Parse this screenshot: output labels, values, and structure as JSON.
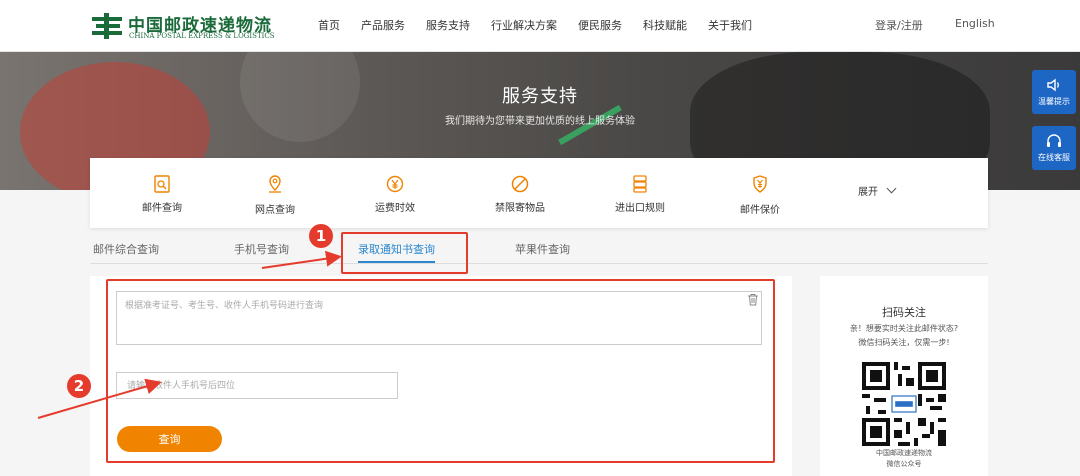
{
  "header": {
    "logo_cn": "中国邮政速递物流",
    "logo_en": "CHINA POSTAL EXPRESS & LOGISTICS",
    "nav": [
      "首页",
      "产品服务",
      "服务支持",
      "行业解决方案",
      "便民服务",
      "科技赋能",
      "关于我们"
    ],
    "login": "登录/注册",
    "language": "English"
  },
  "banner": {
    "title": "服务支持",
    "subtitle": "我们期待为您带来更加优质的线上服务体验"
  },
  "side_buttons": [
    {
      "label": "温馨提示",
      "icon": "speaker-icon"
    },
    {
      "label": "在线客服",
      "icon": "headset-icon"
    }
  ],
  "services": {
    "items": [
      {
        "label": "邮件查询",
        "icon": "mail-search-icon"
      },
      {
        "label": "网点查询",
        "icon": "location-pin-icon"
      },
      {
        "label": "运费时效",
        "icon": "yen-clock-icon"
      },
      {
        "label": "禁限寄物品",
        "icon": "prohibited-icon"
      },
      {
        "label": "进出口规则",
        "icon": "rules-icon"
      },
      {
        "label": "邮件保价",
        "icon": "yen-shield-icon"
      }
    ],
    "expand_label": "展开"
  },
  "tabs": [
    {
      "label": "邮件综合查询",
      "active": false
    },
    {
      "label": "手机号查询",
      "active": false
    },
    {
      "label": "录取通知书查询",
      "active": true
    },
    {
      "label": "苹果件查询",
      "active": false
    }
  ],
  "form": {
    "query_placeholder": "根据准考证号、考生号、收件人手机号码进行查询",
    "phone_placeholder": "请输入收件人手机号后四位",
    "submit_label": "查询"
  },
  "annotations": {
    "marker_1": "1",
    "marker_2": "2"
  },
  "qr_panel": {
    "title": "扫码关注",
    "desc_line1": "亲！想要实时关注此邮件状态?",
    "desc_line2": "微信扫码关注，仅需一步!",
    "caption_line1": "中国邮政速递物流",
    "caption_line2": "微信公众号"
  },
  "colors": {
    "accent_orange": "#f08300",
    "active_tab_blue": "#2a87d0",
    "annotation_red": "#e53b2c",
    "brand_green": "#1b6a3a",
    "side_button_blue": "#1d66c4"
  }
}
